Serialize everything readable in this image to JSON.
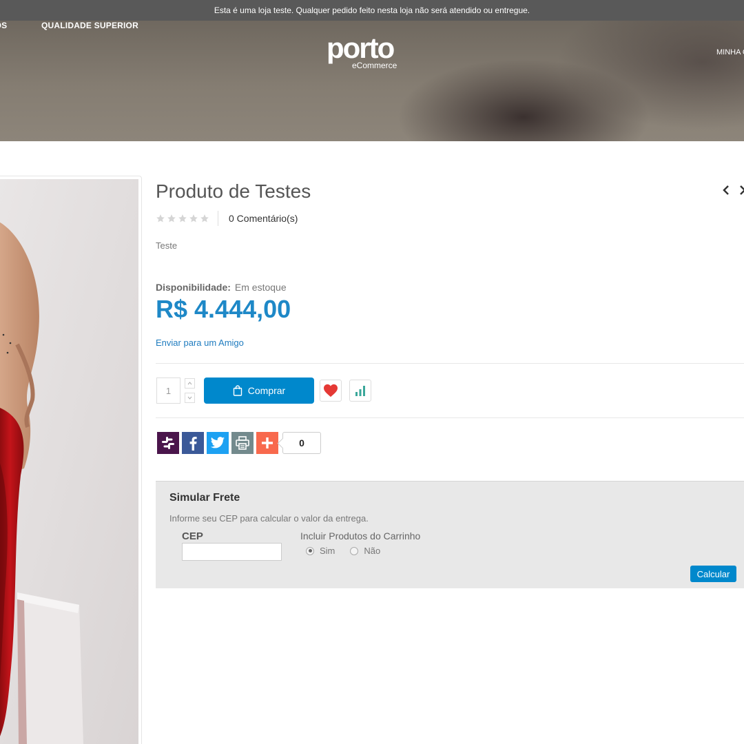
{
  "notice": {
    "text": "Esta é uma loja teste. Qualquer pedido feito nesta loja não será atendido ou entregue."
  },
  "header": {
    "nav_left": [
      "E NÓS",
      "QUALIDADE SUPERIOR"
    ],
    "logo": {
      "main": "porto",
      "sub": "eCommerce"
    },
    "nav_right": "MINHA C"
  },
  "product": {
    "title": "Produto de Testes",
    "rating": {
      "stars": 0,
      "max": 5
    },
    "reviews_label": "0 Comentário(s)",
    "short_description": "Teste",
    "availability_label": "Disponibilidade:",
    "availability_value": "Em estoque",
    "price": "R$ 4.444,00",
    "send_to_friend": "Enviar para um Amigo",
    "quantity": "1",
    "buy_label": "Comprar",
    "share_count": "0"
  },
  "share_icons": [
    "slack-icon",
    "facebook-icon",
    "twitter-icon",
    "print-icon",
    "addthis-plus-icon"
  ],
  "shipping": {
    "title": "Simular Frete",
    "hint": "Informe seu CEP para calcular o valor da entrega.",
    "cep_label": "CEP",
    "cep_value": "",
    "include_label": "Incluir Produtos do Carrinho",
    "options": [
      "Sim",
      "Não"
    ],
    "selected": "Sim",
    "calculate_label": "Calcular"
  },
  "colors": {
    "accent": "#0088cc",
    "price": "#1e88c7",
    "heart": "#e53935",
    "compare": "#3aa79a",
    "slack": "#4a154b",
    "facebook": "#3b5998",
    "twitter": "#1da1f2",
    "print": "#738a8d",
    "addthis": "#f8694d"
  }
}
